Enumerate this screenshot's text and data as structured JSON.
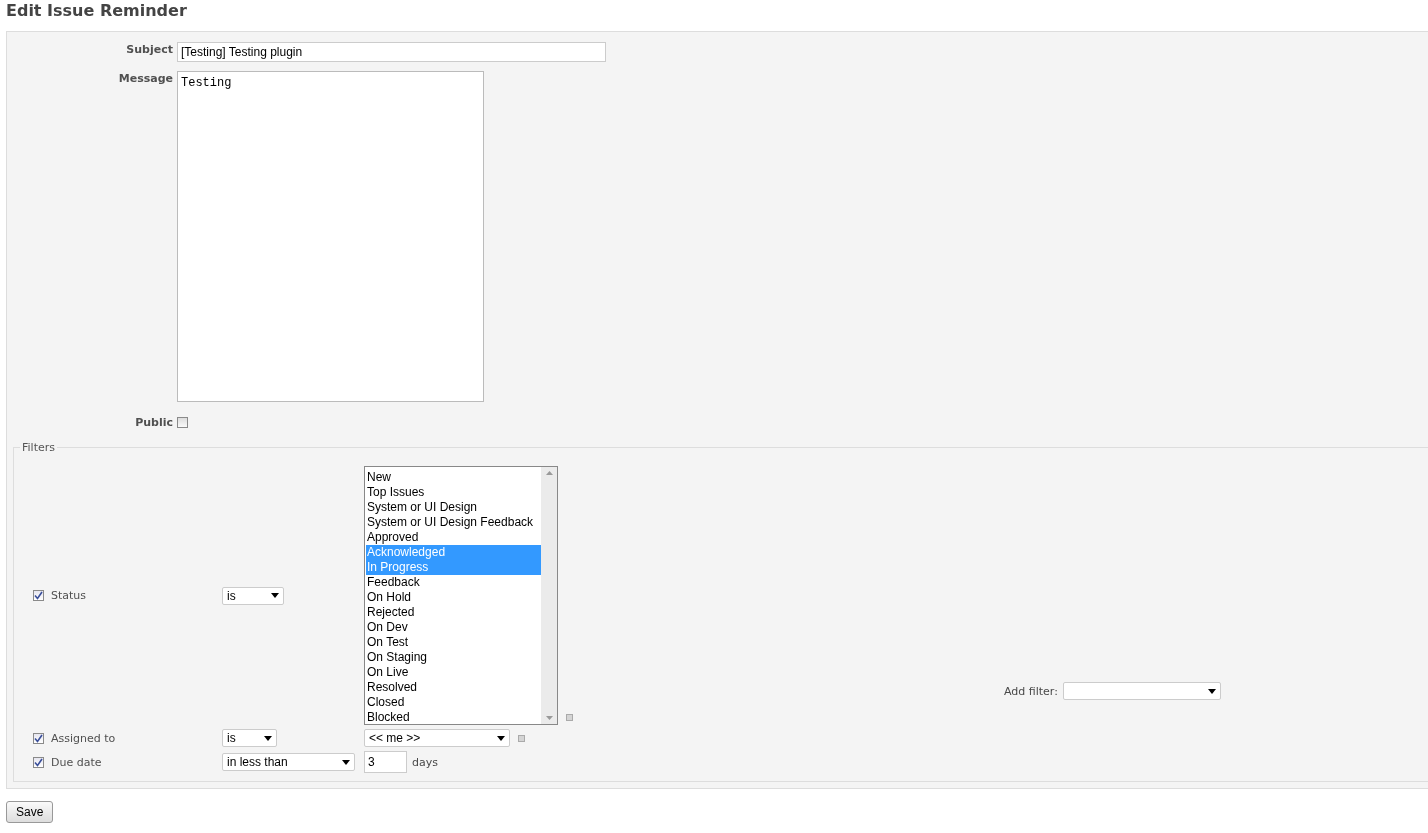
{
  "title": "Edit Issue Reminder",
  "form": {
    "subject": {
      "label": "Subject",
      "value": "[Testing] Testing plugin"
    },
    "message": {
      "label": "Message",
      "value": "Testing"
    },
    "public": {
      "label": "Public",
      "checked": false
    }
  },
  "filters": {
    "legend": "Filters",
    "rows": [
      {
        "kind": "listbox",
        "label": "Status",
        "enabled": true,
        "operator": "is",
        "options": [
          {
            "label": "New",
            "selected": false
          },
          {
            "label": "Top Issues",
            "selected": false
          },
          {
            "label": "System or UI Design",
            "selected": false
          },
          {
            "label": "System or UI Design Feedback",
            "selected": false
          },
          {
            "label": "Approved",
            "selected": false
          },
          {
            "label": "Acknowledged",
            "selected": true
          },
          {
            "label": "In Progress",
            "selected": true
          },
          {
            "label": "Feedback",
            "selected": false
          },
          {
            "label": "On Hold",
            "selected": false
          },
          {
            "label": "Rejected",
            "selected": false
          },
          {
            "label": "On Dev",
            "selected": false
          },
          {
            "label": "On Test",
            "selected": false
          },
          {
            "label": "On Staging",
            "selected": false
          },
          {
            "label": "On Live",
            "selected": false
          },
          {
            "label": "Resolved",
            "selected": false
          },
          {
            "label": "Closed",
            "selected": false
          },
          {
            "label": "Blocked",
            "selected": false
          }
        ]
      },
      {
        "kind": "select",
        "label": "Assigned to",
        "enabled": true,
        "operator": "is",
        "value": "<< me >>"
      },
      {
        "kind": "number",
        "label": "Due date",
        "enabled": true,
        "operator": "in less than",
        "value": "3",
        "unit": "days"
      }
    ],
    "add_filter": {
      "label": "Add filter:"
    }
  },
  "save_button": "Save"
}
